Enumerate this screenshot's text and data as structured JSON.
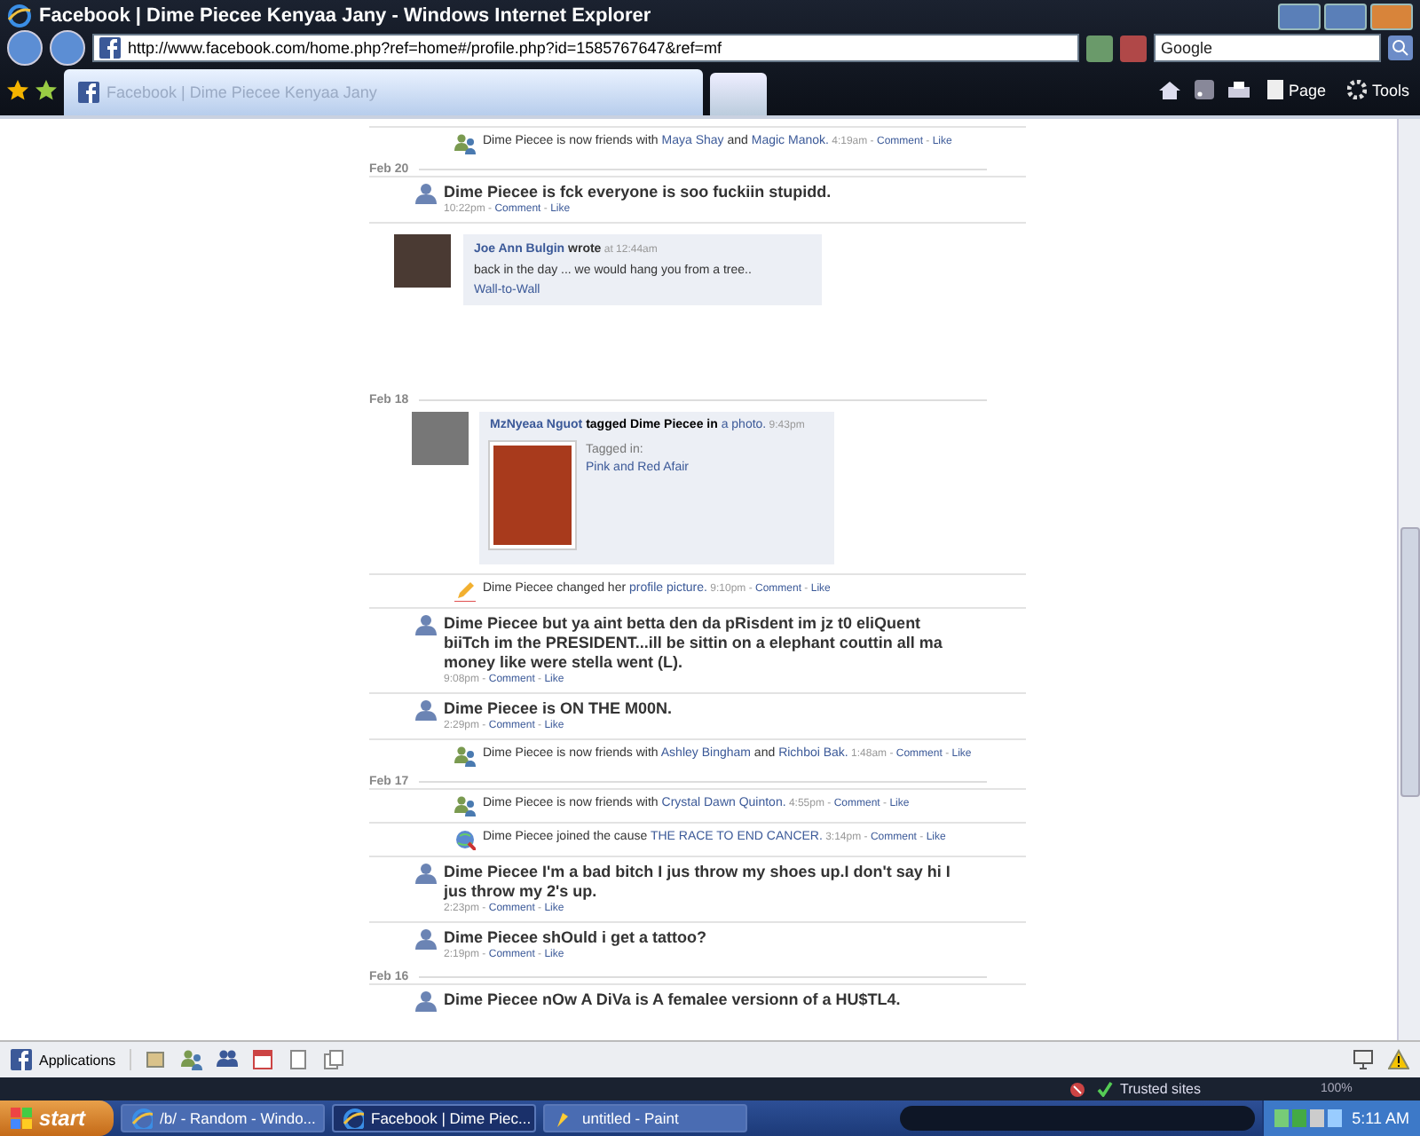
{
  "window": {
    "title": "Facebook | Dime Piecee Kenyaa Jany - Windows Internet Explorer"
  },
  "address_bar": {
    "url": "http://www.facebook.com/home.php?ref=home#/profile.php?id=1585767647&ref=mf",
    "search": "Google"
  },
  "tabs": [
    {
      "label": "Facebook | Dime Piecee Kenyaa Jany",
      "selected": true
    }
  ],
  "command_bar": [
    "Page",
    "Tools"
  ],
  "feed": [
    {
      "kind": "friends",
      "segments": [
        {
          "text": "Dime Piecee is now friends with "
        },
        {
          "text": "Maya Shay",
          "link": true
        },
        {
          "text": " and "
        },
        {
          "text": "Magic Manok.",
          "link": true
        }
      ],
      "meta": {
        "time": "4:19am",
        "sep": "-",
        "actions": [
          "Comment",
          "Like"
        ]
      }
    },
    {
      "kind": "date",
      "label": "Feb 20"
    },
    {
      "kind": "status",
      "text": "Dime Piecee is fck everyone is soo fuckiin stupidd.",
      "meta": {
        "time": "10:22pm",
        "sep": "-",
        "actions": [
          "Comment",
          "Like"
        ]
      }
    },
    {
      "kind": "wall",
      "author": "Joe Ann Bulgin",
      "verb": "wrote",
      "time": "at 12:44am",
      "body": "back in the day ... we would hang you from a tree..",
      "link": "Wall-to-Wall"
    },
    {
      "kind": "date",
      "label": "Feb 18"
    },
    {
      "kind": "tagged",
      "author": "MzNyeaa Nguot",
      "verb": "tagged Dime Piecee in",
      "link": "a photo.",
      "time": "9:43pm",
      "tagged_label": "Tagged in:",
      "album": "Pink and Red Afair"
    },
    {
      "kind": "profile_picture",
      "segments": [
        {
          "text": "Dime Piecee changed her "
        },
        {
          "text": "profile picture.",
          "link": true
        }
      ],
      "meta": {
        "time": "9:10pm",
        "sep": "-",
        "actions": [
          "Comment",
          "Like"
        ]
      }
    },
    {
      "kind": "status",
      "text": "Dime Piecee but ya aint betta den da pRisdent im jz t0 eliQuent biiTch im the PRESIDENT...ill be sittin on a elephant couttin all ma money like were stella went (L).",
      "meta": {
        "time": "9:08pm",
        "sep": "-",
        "actions": [
          "Comment",
          "Like"
        ]
      }
    },
    {
      "kind": "status",
      "text": "Dime Piecee is ON THE M00N.",
      "meta": {
        "time": "2:29pm",
        "sep": "-",
        "actions": [
          "Comment",
          "Like"
        ]
      }
    },
    {
      "kind": "friends",
      "segments": [
        {
          "text": "Dime Piecee is now friends with "
        },
        {
          "text": "Ashley Bingham",
          "link": true
        },
        {
          "text": " and "
        },
        {
          "text": "Richboi Bak.",
          "link": true
        }
      ],
      "meta": {
        "time": "1:48am",
        "sep": "-",
        "actions": [
          "Comment",
          "Like"
        ]
      }
    },
    {
      "kind": "date",
      "label": "Feb 17"
    },
    {
      "kind": "friends",
      "segments": [
        {
          "text": "Dime Piecee is now friends with "
        },
        {
          "text": "Crystal Dawn Quinton.",
          "link": true
        }
      ],
      "meta": {
        "time": "4:55pm",
        "sep": "-",
        "actions": [
          "Comment",
          "Like"
        ]
      }
    },
    {
      "kind": "cause",
      "segments": [
        {
          "text": "Dime Piecee joined the cause "
        },
        {
          "text": "THE RACE TO END CANCER.",
          "link": true
        }
      ],
      "meta": {
        "time": "3:14pm",
        "sep": "-",
        "actions": [
          "Comment",
          "Like"
        ]
      }
    },
    {
      "kind": "status",
      "text": "Dime Piecee I'm a bad bitch I jus throw my shoes up.I don't say hi I jus throw my 2's up.",
      "meta": {
        "time": "2:23pm",
        "sep": "-",
        "actions": [
          "Comment",
          "Like"
        ]
      }
    },
    {
      "kind": "status",
      "text": "Dime Piecee shOuld i get a tattoo?",
      "meta": {
        "time": "2:19pm",
        "sep": "-",
        "actions": [
          "Comment",
          "Like"
        ]
      }
    },
    {
      "kind": "date",
      "label": "Feb 16"
    },
    {
      "kind": "status",
      "text": "Dime Piecee nOw A DiVa is A femalee versionn of a HU$TL4."
    }
  ],
  "fb_bar": {
    "applications": "Applications"
  },
  "status_bar": {
    "zone": "Trusted sites",
    "zoom": "100%"
  },
  "taskbar": {
    "start": "start",
    "tasks": [
      {
        "label": "/b/ - Random - Windo...",
        "selected": false
      },
      {
        "label": "Facebook | Dime Piec...",
        "selected": true
      },
      {
        "label": "untitled - Paint",
        "selected": false
      }
    ],
    "clock": "5:11 AM"
  }
}
